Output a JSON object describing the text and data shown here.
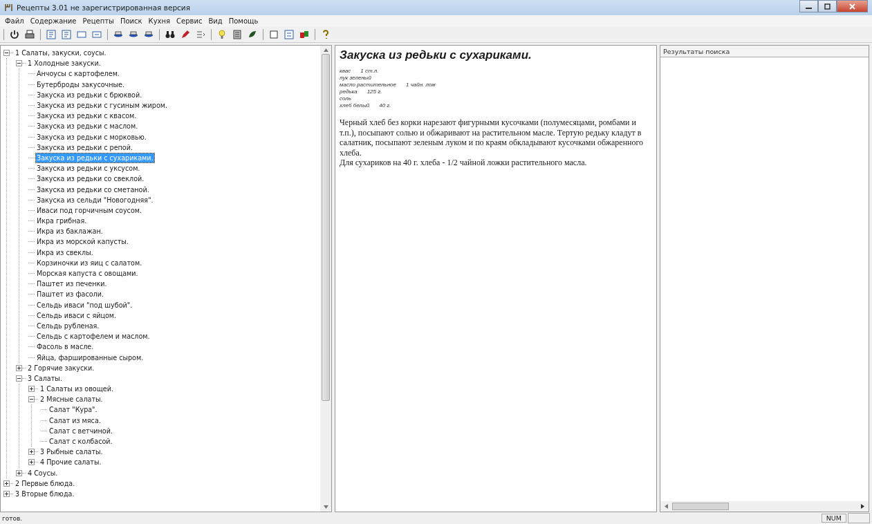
{
  "window": {
    "title": "Рецепты 3.01 не зарегистрированная версия"
  },
  "menu": [
    "Файл",
    "Содержание",
    "Рецепты",
    "Поиск",
    "Кухня",
    "Сервис",
    "Вид",
    "Помощь"
  ],
  "tree": [
    {
      "label": "1 Салаты, закуски, соусы.",
      "expanded": true,
      "selected": false,
      "children": [
        {
          "label": "1 Холодные закуски.",
          "expanded": true,
          "selected": false,
          "children": [
            {
              "label": "Анчоусы с картофелем.",
              "selected": false
            },
            {
              "label": "Бутерброды закусочные.",
              "selected": false
            },
            {
              "label": "Закуска из редьки с брюквой.",
              "selected": false
            },
            {
              "label": "Закуска из редьки с гусиным жиром.",
              "selected": false
            },
            {
              "label": "Закуска из редьки с квасом.",
              "selected": false
            },
            {
              "label": "Закуска из редьки с маслом.",
              "selected": false
            },
            {
              "label": "Закуска из редьки с морковью.",
              "selected": false
            },
            {
              "label": "Закуска из редьки с репой.",
              "selected": false
            },
            {
              "label": "Закуска из редьки с сухариками.",
              "selected": true
            },
            {
              "label": "Закуска из редьки с уксусом.",
              "selected": false
            },
            {
              "label": "Закуска из редьки со свеклой.",
              "selected": false
            },
            {
              "label": "Закуска из редьки со сметаной.",
              "selected": false
            },
            {
              "label": "Закуска из сельди \"Новогодняя\".",
              "selected": false
            },
            {
              "label": "Иваси под горчичным соусом.",
              "selected": false
            },
            {
              "label": "Икра грибная.",
              "selected": false
            },
            {
              "label": "Икра из баклажан.",
              "selected": false
            },
            {
              "label": "Икра из морской капусты.",
              "selected": false
            },
            {
              "label": "Икра из свеклы.",
              "selected": false
            },
            {
              "label": "Корзиночки из яиц с салатом.",
              "selected": false
            },
            {
              "label": "Морская капуста с овощами.",
              "selected": false
            },
            {
              "label": "Паштет из печенки.",
              "selected": false
            },
            {
              "label": "Паштет из фасоли.",
              "selected": false
            },
            {
              "label": "Сельдь иваси \"под шубой\".",
              "selected": false
            },
            {
              "label": "Сельдь иваси с яйцом.",
              "selected": false
            },
            {
              "label": "Сельдь рубленая.",
              "selected": false
            },
            {
              "label": "Сельдь с картофелем и маслом.",
              "selected": false
            },
            {
              "label": "Фасоль в масле.",
              "selected": false
            },
            {
              "label": "Яйца, фаршированные сыром.",
              "selected": false
            }
          ]
        },
        {
          "label": "2 Горячие закуски.",
          "expanded": false,
          "selected": false
        },
        {
          "label": "3 Салаты.",
          "expanded": true,
          "selected": false,
          "children": [
            {
              "label": "1 Салаты из овощей.",
              "expanded": false,
              "selected": false
            },
            {
              "label": "2 Мясные салаты.",
              "expanded": true,
              "selected": false,
              "children": [
                {
                  "label": "Салат \"Кура\".",
                  "selected": false
                },
                {
                  "label": "Салат из мяса.",
                  "selected": false
                },
                {
                  "label": "Салат с ветчиной.",
                  "selected": false
                },
                {
                  "label": "Салат с колбасой.",
                  "selected": false
                }
              ]
            },
            {
              "label": "3 Рыбные салаты.",
              "expanded": false,
              "selected": false
            },
            {
              "label": "4 Прочие салаты.",
              "expanded": false,
              "selected": false
            }
          ]
        },
        {
          "label": "4 Соусы.",
          "expanded": false,
          "selected": false
        }
      ]
    },
    {
      "label": "2 Первые блюда.",
      "expanded": false,
      "selected": false
    },
    {
      "label": "3 Вторые блюда.",
      "expanded": false,
      "selected": false
    }
  ],
  "recipe": {
    "title": "Закуска из редьки с сухариками.",
    "ingredients": [
      {
        "name": "квас",
        "amount": "1 ст.л."
      },
      {
        "name": "лук зеленый"
      },
      {
        "name": "масло растительное",
        "amount": "1 чайн. лож"
      },
      {
        "name": "редька",
        "amount": "125 г."
      },
      {
        "name": "соль"
      },
      {
        "name": "хлеб белый",
        "amount": "40 г."
      }
    ],
    "paragraphs": [
      "Черный хлеб без корки нарезают фигурными кусочками (полумесяцами, ромбами и т.п.), посыпают солью и обжаривают на растительном масле. Тертую редьку кладут в салатник, посыпают зеленым луком и по краям обкладывают кусочками обжаренного хлеба.",
      "Для сухариков на 40 г. хлеба - 1/2 чайной ложки растительного масла."
    ]
  },
  "results": {
    "header": "Результаты поиска"
  },
  "status_bar": {
    "text": "готов.",
    "indicator": "NUM"
  }
}
